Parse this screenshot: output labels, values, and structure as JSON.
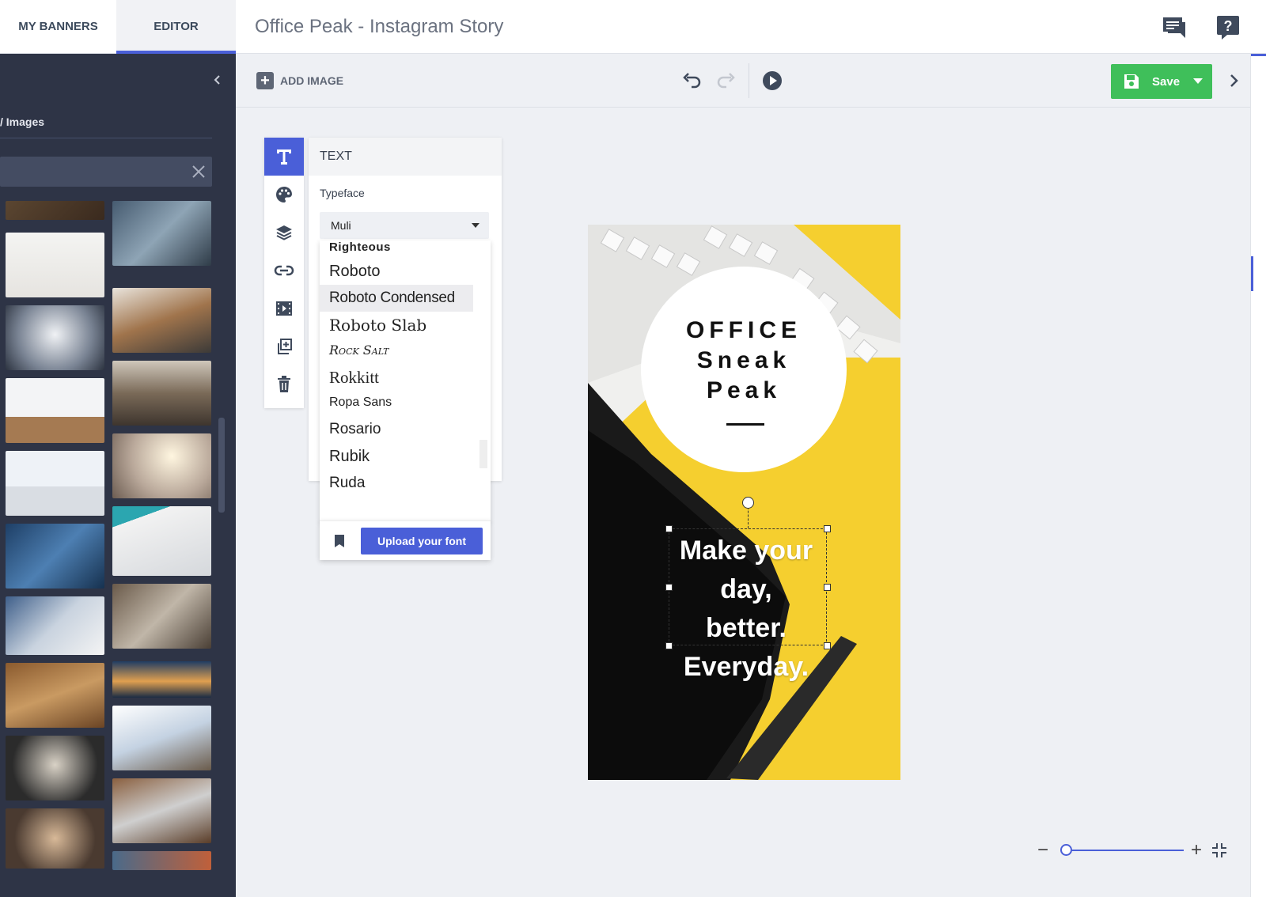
{
  "header": {
    "tabs": [
      {
        "label": "MY BANNERS"
      },
      {
        "label": "EDITOR",
        "active": true
      }
    ],
    "title": "Office Peak - Instagram Story",
    "icons": [
      "chat-icon",
      "help-icon"
    ]
  },
  "left_panel": {
    "heading": "/ Images",
    "search": {
      "value": "",
      "placeholder": ""
    },
    "thumbnail_count": 24
  },
  "toolbar": {
    "add_image_label": "ADD IMAGE",
    "save_label": "Save",
    "save_color": "#3fbf5a",
    "accent_color": "#4a5fd8"
  },
  "text_panel": {
    "title": "TEXT",
    "typeface_label": "Typeface",
    "typeface_value": "Muli",
    "font_options": [
      "Righteous",
      "Roboto",
      "Roboto Condensed",
      "Roboto Slab",
      "Rock Salt",
      "Rokkitt",
      "Ropa Sans",
      "Rosario",
      "Rubik",
      "Ruda"
    ],
    "highlighted_font": "Roboto Condensed",
    "upload_label": "Upload your font"
  },
  "canvas": {
    "circle_lines": [
      "OFFICE",
      "Sneak",
      "Peak"
    ],
    "body_lines": [
      "Make your",
      "day,",
      "better.",
      "Everyday."
    ],
    "background_color": "#f5cf2f"
  },
  "zoom": {
    "level": 0.0
  }
}
